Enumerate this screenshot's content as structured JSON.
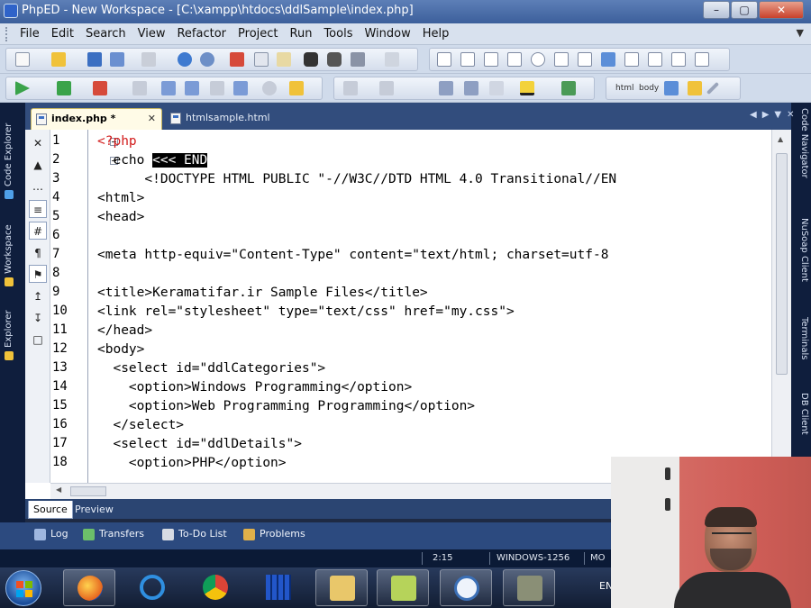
{
  "window": {
    "title": "PhpED - New Workspace - [C:\\xampp\\htdocs\\ddlSample\\index.php]"
  },
  "menu": {
    "items": [
      "File",
      "Edit",
      "Search",
      "View",
      "Refactor",
      "Project",
      "Run",
      "Tools",
      "Window",
      "Help"
    ]
  },
  "toolbar": {
    "html_label": "html",
    "body_label": "body"
  },
  "left_dock": {
    "tabs": [
      "Code Explorer",
      "Workspace",
      "Explorer"
    ]
  },
  "right_dock": {
    "tabs": [
      "Code Navigator",
      "NuSoap Client",
      "Terminals",
      "DB Client"
    ]
  },
  "tabs": [
    {
      "label": "index.php *",
      "active": true
    },
    {
      "label": "htmlsample.html",
      "active": false
    }
  ],
  "editor": {
    "lines": [
      {
        "n": "1",
        "parts": [
          {
            "t": "<?php",
            "c": "red"
          }
        ]
      },
      {
        "n": "2",
        "parts": [
          {
            "t": "  echo ",
            "c": "blk"
          },
          {
            "t": "<<< END",
            "c": "sel"
          }
        ]
      },
      {
        "n": "3",
        "parts": [
          {
            "t": "      <!DOCTYPE HTML PUBLIC \"-//W3C//DTD HTML 4.0 Transitional//EN",
            "c": "grn"
          }
        ]
      },
      {
        "n": "4",
        "parts": [
          {
            "t": "<html>",
            "c": "grn"
          }
        ]
      },
      {
        "n": "5",
        "parts": [
          {
            "t": "<head>",
            "c": "grn"
          }
        ]
      },
      {
        "n": "6",
        "parts": [
          {
            "t": "",
            "c": "grn"
          }
        ]
      },
      {
        "n": "7",
        "parts": [
          {
            "t": "<meta http-equiv=\"Content-Type\" content=\"text/html; charset=utf-8",
            "c": "grn"
          }
        ]
      },
      {
        "n": "8",
        "parts": [
          {
            "t": "",
            "c": "grn"
          }
        ]
      },
      {
        "n": "9",
        "parts": [
          {
            "t": "<title>Keramatifar.ir Sample Files</title>",
            "c": "grn"
          }
        ]
      },
      {
        "n": "10",
        "parts": [
          {
            "t": "<link rel=\"stylesheet\" type=\"text/css\" href=\"my.css\">",
            "c": "grn"
          }
        ]
      },
      {
        "n": "11",
        "parts": [
          {
            "t": "</head>",
            "c": "grn"
          }
        ]
      },
      {
        "n": "12",
        "parts": [
          {
            "t": "<body>",
            "c": "grn"
          }
        ]
      },
      {
        "n": "13",
        "parts": [
          {
            "t": "  <select id=\"ddlCategories\">",
            "c": "grn"
          }
        ]
      },
      {
        "n": "14",
        "parts": [
          {
            "t": "    <option>Windows Programming</option>",
            "c": "grn"
          }
        ]
      },
      {
        "n": "15",
        "parts": [
          {
            "t": "    <option>Web Programming Programming</option>",
            "c": "grn"
          }
        ]
      },
      {
        "n": "16",
        "parts": [
          {
            "t": "  </select>",
            "c": "grn"
          }
        ]
      },
      {
        "n": "17",
        "parts": [
          {
            "t": "  <select id=\"ddlDetails\">",
            "c": "grn"
          }
        ]
      },
      {
        "n": "18",
        "parts": [
          {
            "t": "    <option>PHP</option>",
            "c": "grn"
          }
        ]
      }
    ]
  },
  "view_tabs": [
    "Source",
    "Preview"
  ],
  "panel_tabs": [
    "Log",
    "Transfers",
    "To-Do List",
    "Problems"
  ],
  "status": {
    "position": "2:15",
    "encoding": "WINDOWS-1256",
    "mode": "MO"
  },
  "taskbar": {
    "lang": "EN"
  },
  "colors": {
    "keyword": "#d21b1b",
    "string": "#137a13",
    "selection": "#000000",
    "dock": "#0f1e3d"
  }
}
